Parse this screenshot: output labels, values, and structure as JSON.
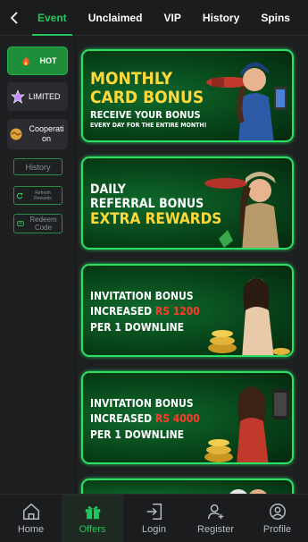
{
  "tabs": [
    {
      "label": "Event",
      "active": true
    },
    {
      "label": "Unclaimed"
    },
    {
      "label": "VIP"
    },
    {
      "label": "History"
    },
    {
      "label": "Spins"
    }
  ],
  "sidebar": {
    "hot": "HOT",
    "limited": "LIMITED",
    "cooperation": "Cooperati\non",
    "history": "History",
    "refresh": "Refresh Rewards",
    "redeem": "Redeem Code"
  },
  "banners": [
    {
      "l1": "MONTHLY",
      "l2": "CARD BONUS",
      "l3": "RECEIVE YOUR BONUS",
      "l4": "EVERY DAY FOR THE ENTIRE MONTH!"
    },
    {
      "l1": "DAILY",
      "l2": "REFERRAL BONUS",
      "l3": "EXTRA REWARDS"
    },
    {
      "l1": "INVITATION BONUS",
      "l2a": "INCREASED ",
      "l2b": "RS 1200",
      "l3": "PER 1 DOWNLINE"
    },
    {
      "l1": "INVITATION BONUS",
      "l2a": "INCREASED ",
      "l2b": "RS 4000",
      "l3": "PER 1 DOWNLINE"
    }
  ],
  "nav": [
    {
      "label": "Home",
      "icon": "home-icon"
    },
    {
      "label": "Offers",
      "icon": "gift-icon",
      "active": true
    },
    {
      "label": "Login",
      "icon": "login-icon"
    },
    {
      "label": "Register",
      "icon": "add-user-icon"
    },
    {
      "label": "Profile",
      "icon": "profile-icon"
    }
  ],
  "colors": {
    "accent": "#23c55e",
    "banner_green": "#074218",
    "yellow": "#ffd83a",
    "red": "#ff3b30"
  }
}
